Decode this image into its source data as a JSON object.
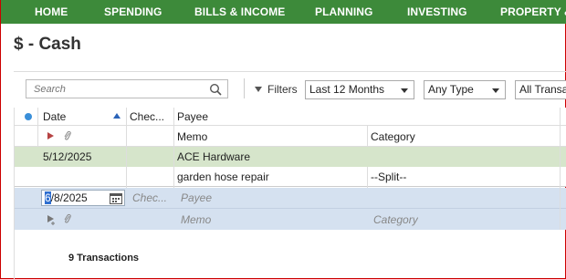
{
  "nav": {
    "items": [
      "HOME",
      "SPENDING",
      "BILLS & INCOME",
      "PLANNING",
      "INVESTING",
      "PROPERTY & D"
    ]
  },
  "page": {
    "title": "$ - Cash"
  },
  "toolbar": {
    "search_placeholder": "Search",
    "filters_label": "Filters",
    "date_filter": "Last 12 Months",
    "type_filter": "Any Type",
    "trans_filter": "All Transac"
  },
  "grid": {
    "headers": {
      "date": "Date",
      "check": "Chec...",
      "payee": "Payee",
      "memo": "Memo",
      "category": "Category"
    },
    "transaction": {
      "date": "5/12/2025",
      "payee": "ACE Hardware",
      "memo": "garden hose repair",
      "category": "--Split--"
    },
    "new_entry": {
      "date_hl": "6",
      "date_rest": "/8/2025",
      "check_placeholder": "Chec...",
      "payee_placeholder": "Payee",
      "memo_placeholder": "Memo",
      "category_placeholder": "Category"
    }
  },
  "footer": {
    "count": "9 Transactions"
  },
  "colors": {
    "nav_bg": "#3d8a3a",
    "selected_row": "#d6e5cb",
    "edit_row": "#d5e1f0",
    "accent": "#3a8fd9"
  }
}
